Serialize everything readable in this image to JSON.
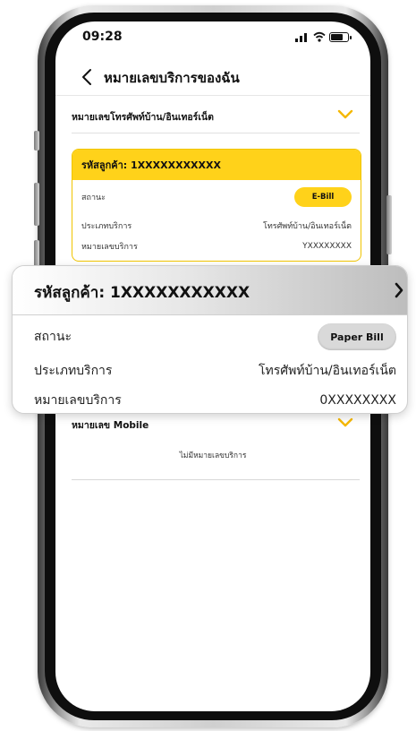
{
  "status_bar": {
    "time": "09:28"
  },
  "header": {
    "title": "หมายเลขบริการของฉัน"
  },
  "fixed_section": {
    "title": "หมายเลขโทรศัพท์บ้าน/อินเทอร์เน็ต"
  },
  "small_card": {
    "customer_code": "รหัสลูกค้า: 1XXXXXXXXXXX",
    "status_label": "สถานะ",
    "status_value": "E-Bill",
    "service_type_label": "ประเภทบริการ",
    "service_type_value": "โทรศัพท์บ้าน/อินเทอร์เน็ต",
    "service_number_label": "หมายเลขบริการ",
    "service_number_value": "YXXXXXXXX"
  },
  "callout": {
    "customer_code": "รหัสลูกค้า: 1XXXXXXXXXXX",
    "status_label": "สถานะ",
    "status_value": "Paper Bill",
    "service_type_label": "ประเภทบริการ",
    "service_type_value": "โทรศัพท์บ้าน/อินเทอร์เน็ต",
    "service_number_label": "หมายเลขบริการ",
    "service_number_value": "0XXXXXXXX"
  },
  "mobile_section": {
    "title": "หมายเลข Mobile",
    "empty_text": "ไม่มีหมายเลขบริการ"
  },
  "colors": {
    "accent": "#ffd21a",
    "accent_border": "#f0c400",
    "pill_grey": "#d9d9d9"
  },
  "icons": [
    "back-icon",
    "chevron-down-icon",
    "chevron-right-icon",
    "signal-icon",
    "wifi-icon",
    "battery-icon"
  ]
}
